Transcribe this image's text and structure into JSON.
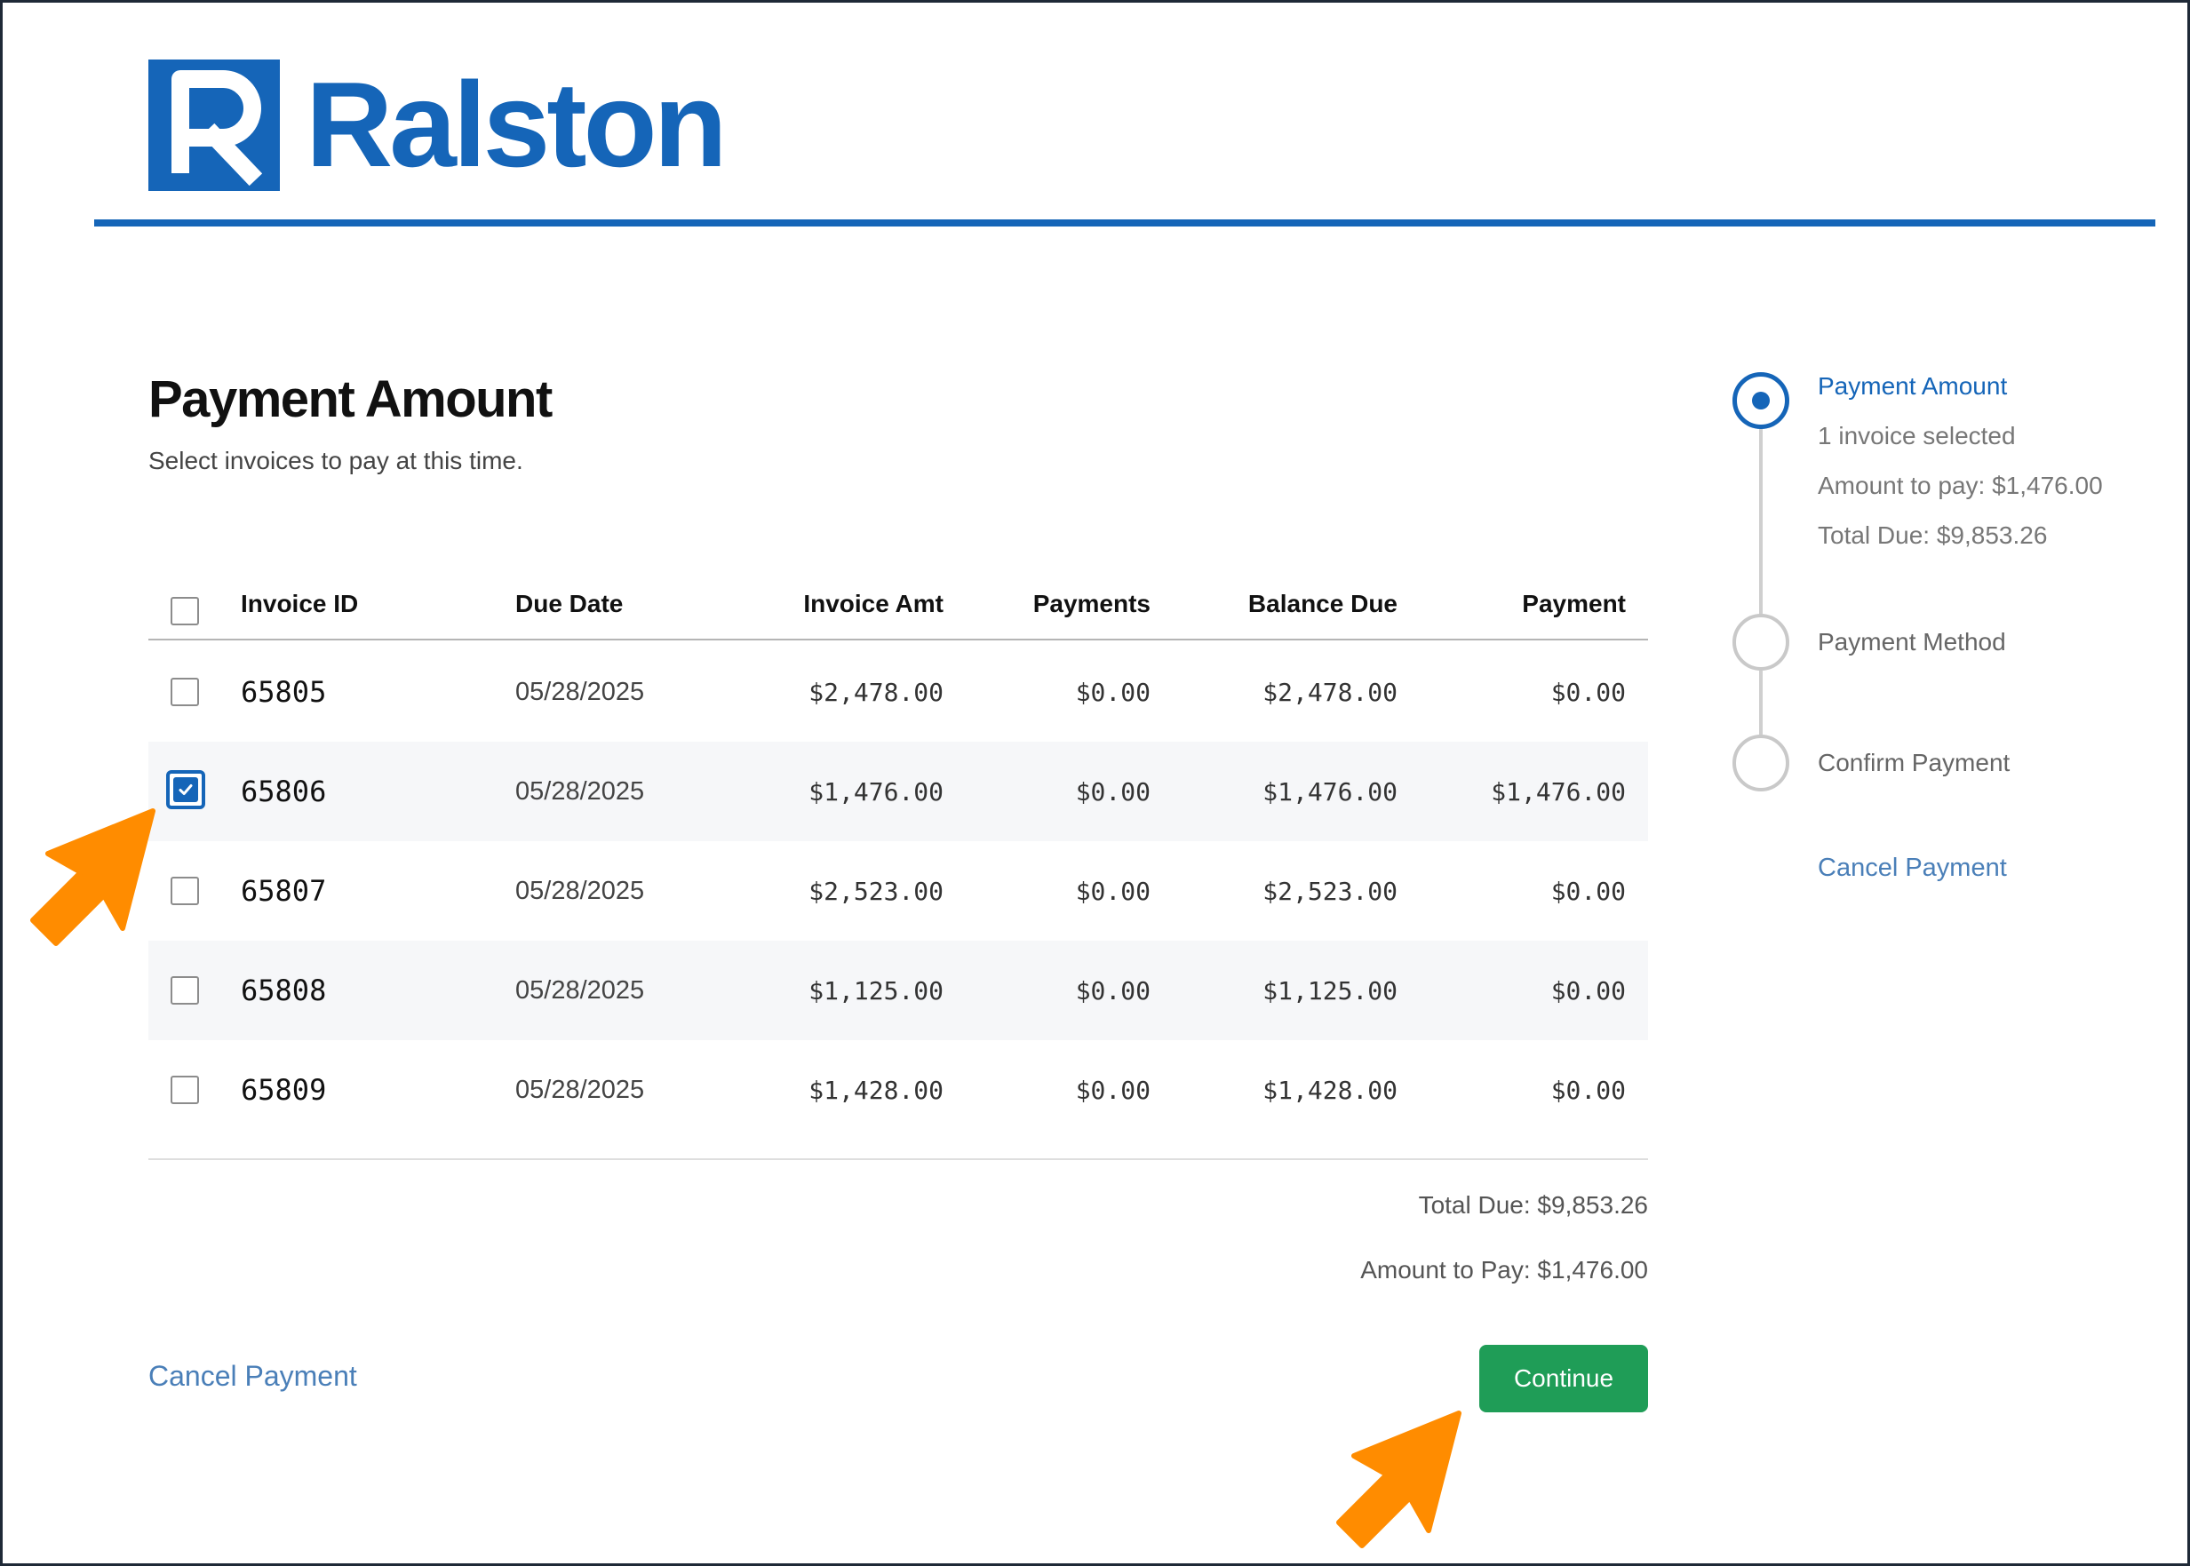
{
  "brand": {
    "name": "Ralston",
    "logo_letter": "R",
    "color": "#1565b8"
  },
  "page": {
    "title": "Payment Amount",
    "subtitle": "Select invoices to pay at this time."
  },
  "table": {
    "headers": [
      "Invoice ID",
      "Due Date",
      "Invoice Amt",
      "Payments",
      "Balance Due",
      "Payment"
    ],
    "rows": [
      {
        "checked": false,
        "id": "65805",
        "due_date": "05/28/2025",
        "invoice_amt": "$2,478.00",
        "payments": "$0.00",
        "balance_due": "$2,478.00",
        "payment": "$0.00"
      },
      {
        "checked": true,
        "id": "65806",
        "due_date": "05/28/2025",
        "invoice_amt": "$1,476.00",
        "payments": "$0.00",
        "balance_due": "$1,476.00",
        "payment": "$1,476.00"
      },
      {
        "checked": false,
        "id": "65807",
        "due_date": "05/28/2025",
        "invoice_amt": "$2,523.00",
        "payments": "$0.00",
        "balance_due": "$2,523.00",
        "payment": "$0.00"
      },
      {
        "checked": false,
        "id": "65808",
        "due_date": "05/28/2025",
        "invoice_amt": "$1,125.00",
        "payments": "$0.00",
        "balance_due": "$1,125.00",
        "payment": "$0.00"
      },
      {
        "checked": false,
        "id": "65809",
        "due_date": "05/28/2025",
        "invoice_amt": "$1,428.00",
        "payments": "$0.00",
        "balance_due": "$1,428.00",
        "payment": "$0.00"
      }
    ]
  },
  "totals": {
    "total_due": "Total Due: $9,853.26",
    "amount_to_pay": "Amount to Pay: $1,476.00"
  },
  "actions": {
    "cancel_label": "Cancel Payment",
    "continue_label": "Continue",
    "continue_color": "#1f9d57"
  },
  "stepper": {
    "steps": [
      {
        "label": "Payment Amount",
        "active": true
      },
      {
        "label": "Payment Method",
        "active": false
      },
      {
        "label": "Confirm Payment",
        "active": false
      }
    ],
    "details": [
      "1 invoice selected",
      "Amount to pay: $1,476.00",
      "Total Due: $9,853.26"
    ],
    "cancel_label": "Cancel Payment"
  },
  "annotations": {
    "arrow_color": "#ff8c00",
    "icon": "orange-pointer-arrow"
  }
}
